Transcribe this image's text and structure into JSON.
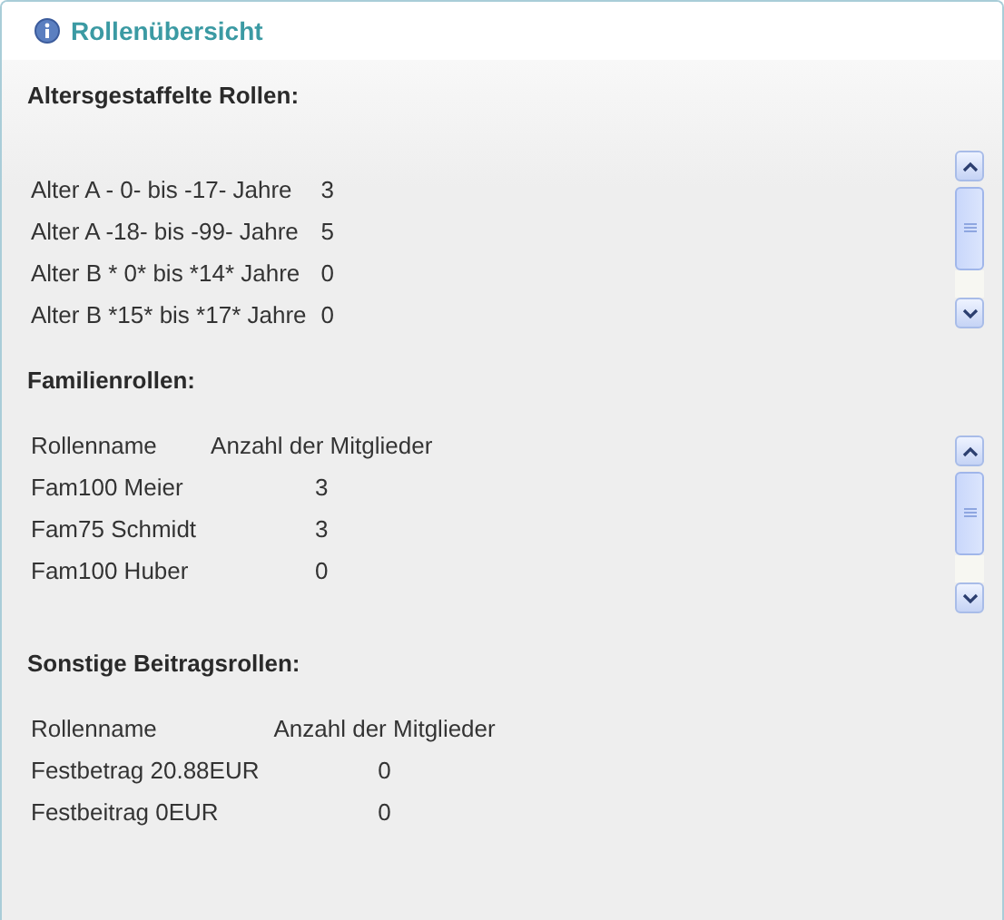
{
  "panel": {
    "title": "Rollenübersicht"
  },
  "sections": [
    {
      "title": "Altersgestaffelte Rollen:",
      "scrollbar": true,
      "rows": [
        [
          "Alter A - 0- bis -17- Jahre",
          "3"
        ],
        [
          "Alter A -18- bis -99- Jahre",
          "5"
        ],
        [
          "Alter B * 0* bis *14* Jahre",
          "0"
        ],
        [
          "Alter B *15* bis *17* Jahre",
          "0"
        ]
      ]
    },
    {
      "title": "Familienrollen:",
      "scrollbar": true,
      "columns": [
        "Rollenname",
        "Anzahl der Mitglieder"
      ],
      "rows": [
        [
          "Fam100 Meier",
          "3"
        ],
        [
          "Fam75 Schmidt",
          "3"
        ],
        [
          "Fam100 Huber",
          "0"
        ]
      ]
    },
    {
      "title": "Sonstige Beitragsrollen:",
      "scrollbar": false,
      "columns": [
        "Rollenname",
        "Anzahl der Mitglieder"
      ],
      "rows": [
        [
          "Festbetrag 20.88EUR",
          "0"
        ],
        [
          "Festbeitrag 0EUR",
          "0"
        ]
      ]
    }
  ]
}
